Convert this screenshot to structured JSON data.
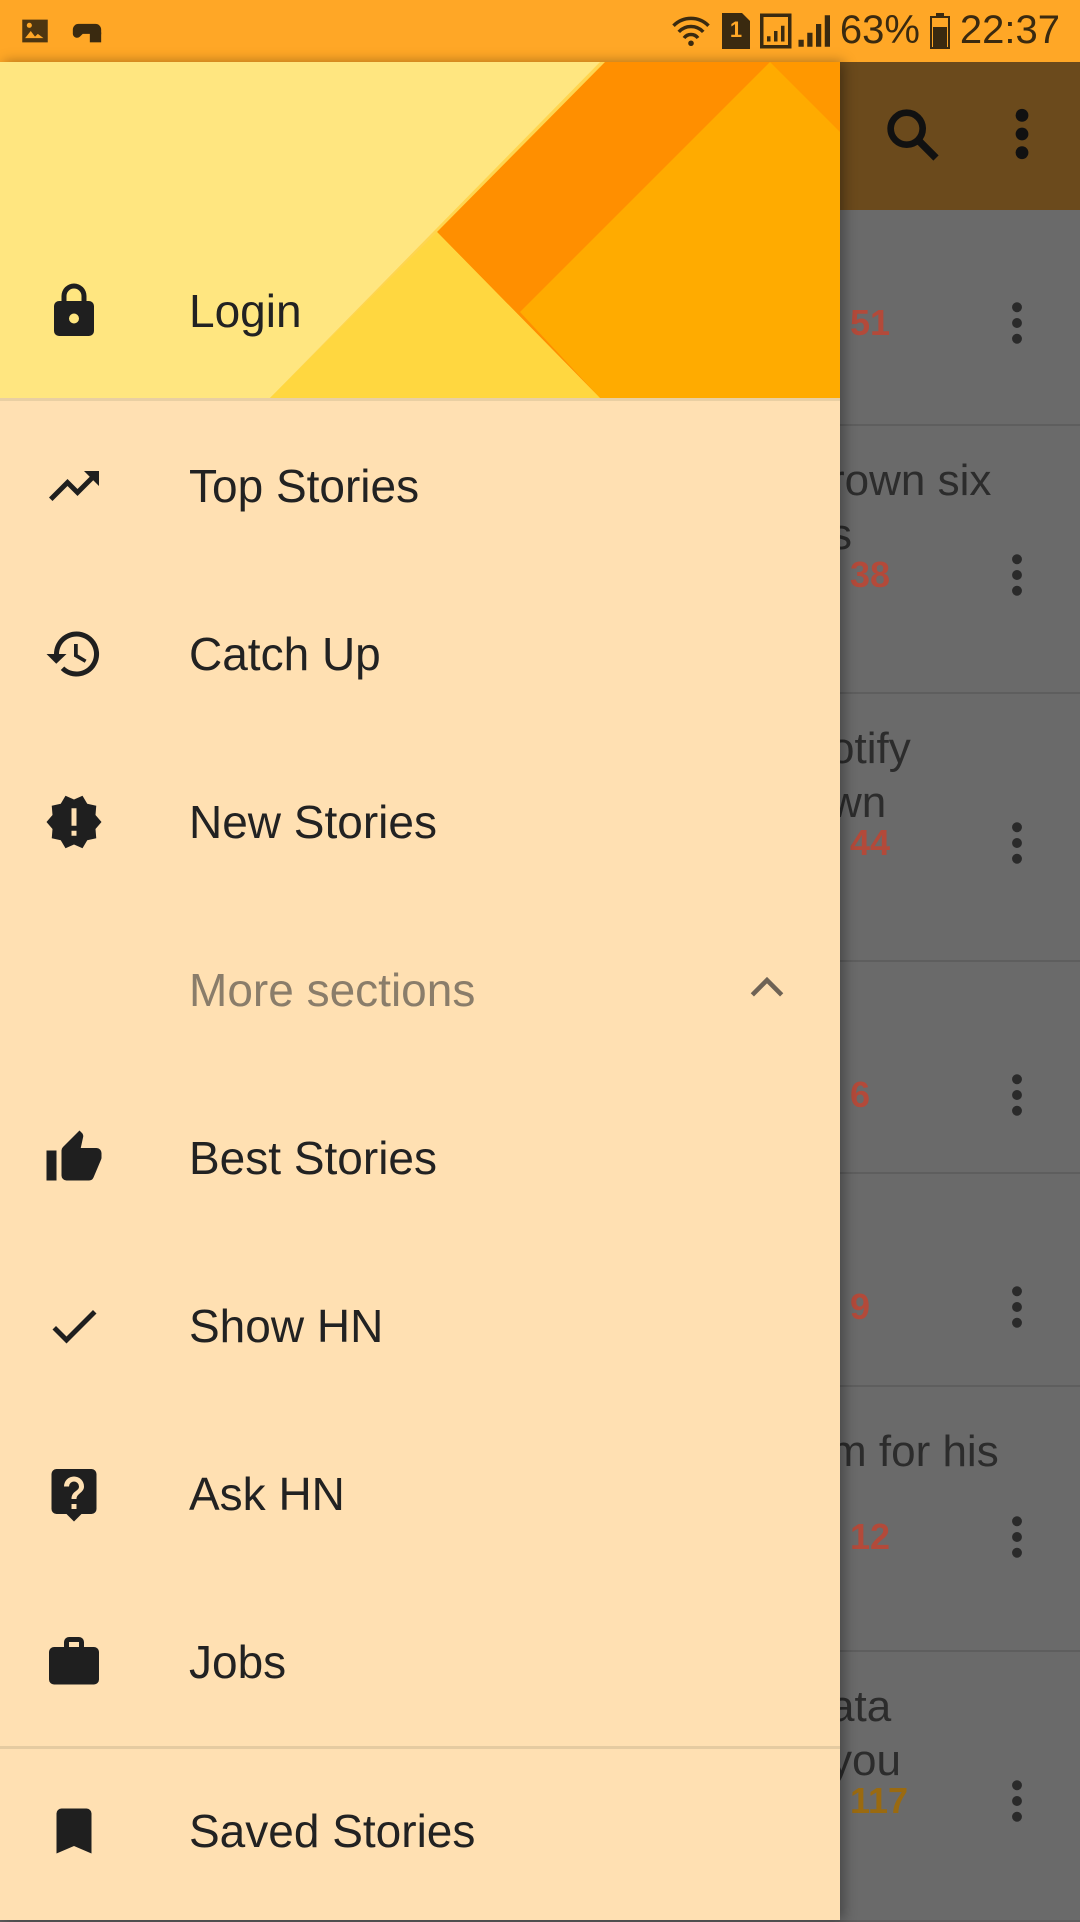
{
  "status_bar": {
    "battery_percent": "63%",
    "time": "22:37",
    "sim_badge": "1",
    "icons": [
      "gallery-icon",
      "game-controller-icon",
      "wifi-icon",
      "sim-icon",
      "signal-icon",
      "battery-icon"
    ]
  },
  "toolbar": {
    "icons": [
      "search-icon",
      "more-vert-icon"
    ]
  },
  "background_list": {
    "rows": [
      {
        "title": "",
        "score": "51",
        "score_color": "#b34a3a"
      },
      {
        "title": "rown six\ns",
        "score": "38",
        "score_color": "#b34a3a"
      },
      {
        "title": "otify\nwn",
        "score": "44",
        "score_color": "#b34a3a"
      },
      {
        "title": "",
        "score": "6",
        "score_color": "#b34a3a"
      },
      {
        "title": "",
        "score": "9",
        "score_color": "#b34a3a"
      },
      {
        "title": "m for his",
        "score": "12",
        "score_color": "#b34a3a"
      },
      {
        "title": "ata\nyou",
        "score": "117",
        "score_color": "#9a6a10"
      }
    ]
  },
  "drawer": {
    "header": {
      "login": {
        "label": "Login",
        "icon": "lock-icon"
      }
    },
    "items": [
      {
        "label": "Top Stories",
        "icon": "trending-up-icon"
      },
      {
        "label": "Catch Up",
        "icon": "history-icon"
      },
      {
        "label": "New Stories",
        "icon": "new-releases-icon"
      }
    ],
    "more_sections": {
      "label": "More sections",
      "icon": "chevron-up-icon"
    },
    "more_items": [
      {
        "label": "Best Stories",
        "icon": "thumb-up-icon"
      },
      {
        "label": "Show HN",
        "icon": "check-icon"
      },
      {
        "label": "Ask HN",
        "icon": "help-icon"
      },
      {
        "label": "Jobs",
        "icon": "work-icon"
      }
    ],
    "saved": {
      "label": "Saved Stories",
      "icon": "bookmark-icon"
    }
  },
  "colors": {
    "status_bar": "#FFA726",
    "drawer_background": "#FFE0B2",
    "toolbar": "#6b4a1c",
    "accent_orange": "#FF8F00"
  }
}
